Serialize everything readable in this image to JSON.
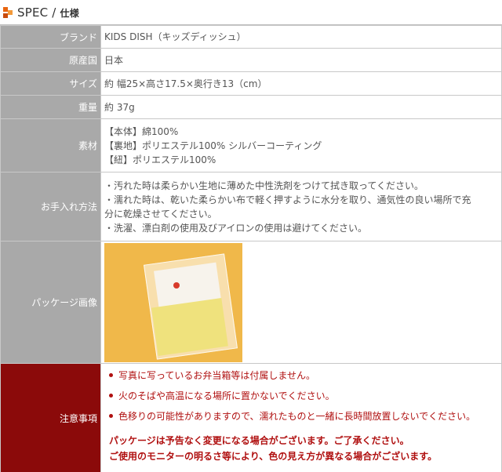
{
  "header": {
    "title_main": "SPEC",
    "title_sep": " / ",
    "title_sub": "仕様"
  },
  "rows": {
    "brand": {
      "label": "ブランド",
      "value": "KIDS DISH（キッズディッシュ）"
    },
    "origin": {
      "label": "原産国",
      "value": "日本"
    },
    "size": {
      "label": "サイズ",
      "value": "約 幅25×高さ17.5×奥行き13（cm）"
    },
    "weight": {
      "label": "重量",
      "value": "約 37g"
    },
    "material": {
      "label": "素材",
      "lines": [
        "【本体】綿100%",
        "【裏地】ポリエステル100% シルバーコーティング",
        "【紐】ポリエステル100%"
      ]
    },
    "care": {
      "label": "お手入れ方法",
      "lines": [
        "・汚れた時は柔らかい生地に薄めた中性洗剤をつけて拭き取ってください。",
        "・濡れた時は、乾いた柔らかい布で軽く押すように水分を取り、通気性の良い場所で充",
        "分に乾燥させてください。",
        "・洗濯、漂白剤の使用及びアイロンの使用は避けてください。"
      ]
    },
    "package": {
      "label": "パッケージ画像"
    },
    "caution": {
      "label": "注意事項",
      "items": [
        "写真に写っているお弁当箱等は付属しません。",
        "火のそばや高温になる場所に置かないでください。",
        "色移りの可能性がありますので、濡れたものと一緒に長時間放置しないでください。"
      ],
      "notice": [
        "パッケージは予告なく変更になる場合がございます。ご了承ください。",
        "ご使用のモニターの明るさ等により、色の見え方が異なる場合がございます。"
      ]
    }
  },
  "colors": {
    "label_bg": "#a9a9a9",
    "caution_bg": "#8b0a0a",
    "caution_text": "#b01010",
    "accent": "#e8650f"
  }
}
